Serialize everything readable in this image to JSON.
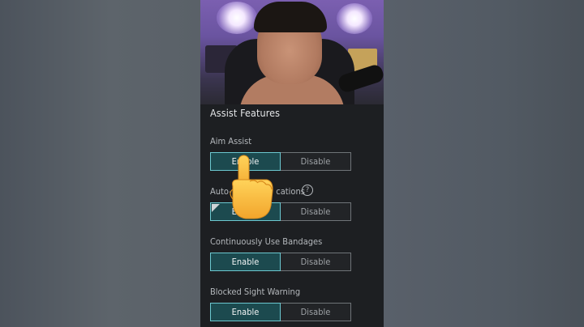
{
  "panel": {
    "title": "Assist Features",
    "settings": [
      {
        "label": "Aim Assist",
        "options": [
          "Enable",
          "Disable"
        ],
        "selected": "Enable"
      },
      {
        "label": "Auto-Medication Notifications",
        "visible_label": "Auto-M",
        "hidden_label_end": "cations",
        "options": [
          "Enable",
          "Disable"
        ],
        "selected": "Enable",
        "has_help_icon": true
      },
      {
        "label": "Continuously Use Bandages",
        "options": [
          "Enable",
          "Disable"
        ],
        "selected": "Enable"
      },
      {
        "label": "Blocked Sight Warning",
        "options": [
          "Enable",
          "Disable"
        ],
        "selected": "Enable"
      }
    ],
    "help_icon": "?"
  },
  "colors": {
    "selected_fill": "#1c4a4f",
    "selected_border": "#6cc8d0",
    "panel_bg": "#1d1f22",
    "pointer_emoji": "#f6b73c"
  },
  "icons": {
    "help": "question-circle-icon",
    "pointer": "pointing-hand-emoji"
  }
}
